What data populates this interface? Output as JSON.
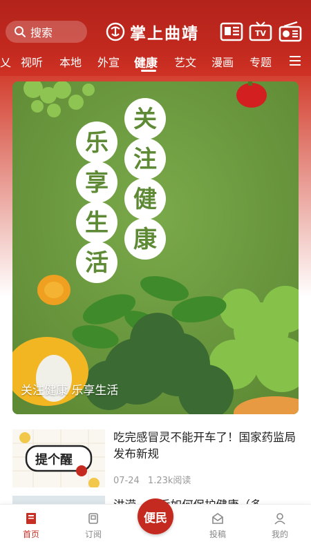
{
  "header": {
    "search_label": "搜索",
    "logo_text": "掌上曲靖",
    "icons": [
      "newspaper-icon",
      "tv-icon",
      "radio-icon"
    ],
    "tv_label": "TV"
  },
  "tabs": {
    "items": [
      {
        "label": "乂"
      },
      {
        "label": "视听"
      },
      {
        "label": "本地"
      },
      {
        "label": "外宣"
      },
      {
        "label": "健康",
        "active": true
      },
      {
        "label": "艺文"
      },
      {
        "label": "漫画"
      },
      {
        "label": "专题"
      }
    ]
  },
  "banner": {
    "headline_left": [
      "乐",
      "享",
      "生",
      "活"
    ],
    "headline_right": [
      "关",
      "注",
      "健",
      "康"
    ],
    "caption": "关注健康 乐享生活"
  },
  "news": [
    {
      "title": "吃完感冒灵不能开车了！国家药监局发布新规",
      "thumb_text": "提个醒",
      "date": "07-24",
      "reads": "1.23k阅读"
    },
    {
      "title": "洪涝……后如何保护健康（多"
    }
  ],
  "bottom_nav": {
    "items": [
      {
        "label": "首页",
        "icon": "home-icon",
        "active": true
      },
      {
        "label": "订阅",
        "icon": "subscribe-icon"
      },
      {
        "label": "投稿",
        "icon": "submit-icon"
      },
      {
        "label": "我的",
        "icon": "profile-icon"
      }
    ],
    "center_label": "便民"
  },
  "colors": {
    "brand_red": "#c42a1f",
    "banner_green": "#6c9a3f"
  }
}
